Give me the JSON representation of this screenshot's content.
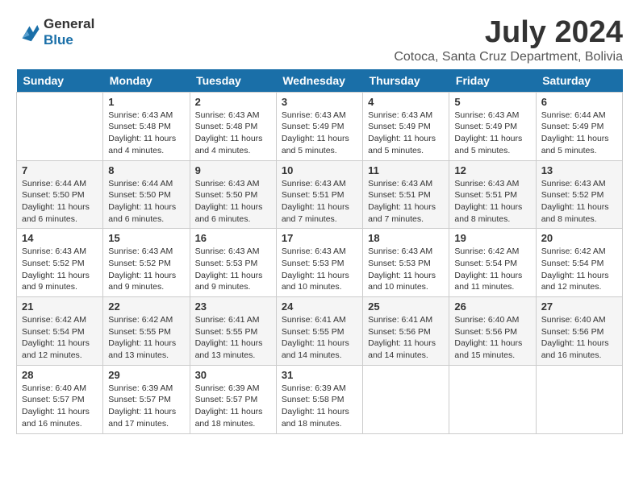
{
  "logo": {
    "line1": "General",
    "line2": "Blue"
  },
  "title": "July 2024",
  "location": "Cotoca, Santa Cruz Department, Bolivia",
  "days_header": [
    "Sunday",
    "Monday",
    "Tuesday",
    "Wednesday",
    "Thursday",
    "Friday",
    "Saturday"
  ],
  "weeks": [
    [
      {
        "day": "",
        "info": ""
      },
      {
        "day": "1",
        "info": "Sunrise: 6:43 AM\nSunset: 5:48 PM\nDaylight: 11 hours\nand 4 minutes."
      },
      {
        "day": "2",
        "info": "Sunrise: 6:43 AM\nSunset: 5:48 PM\nDaylight: 11 hours\nand 4 minutes."
      },
      {
        "day": "3",
        "info": "Sunrise: 6:43 AM\nSunset: 5:49 PM\nDaylight: 11 hours\nand 5 minutes."
      },
      {
        "day": "4",
        "info": "Sunrise: 6:43 AM\nSunset: 5:49 PM\nDaylight: 11 hours\nand 5 minutes."
      },
      {
        "day": "5",
        "info": "Sunrise: 6:43 AM\nSunset: 5:49 PM\nDaylight: 11 hours\nand 5 minutes."
      },
      {
        "day": "6",
        "info": "Sunrise: 6:44 AM\nSunset: 5:49 PM\nDaylight: 11 hours\nand 5 minutes."
      }
    ],
    [
      {
        "day": "7",
        "info": "Sunrise: 6:44 AM\nSunset: 5:50 PM\nDaylight: 11 hours\nand 6 minutes."
      },
      {
        "day": "8",
        "info": "Sunrise: 6:44 AM\nSunset: 5:50 PM\nDaylight: 11 hours\nand 6 minutes."
      },
      {
        "day": "9",
        "info": "Sunrise: 6:43 AM\nSunset: 5:50 PM\nDaylight: 11 hours\nand 6 minutes."
      },
      {
        "day": "10",
        "info": "Sunrise: 6:43 AM\nSunset: 5:51 PM\nDaylight: 11 hours\nand 7 minutes."
      },
      {
        "day": "11",
        "info": "Sunrise: 6:43 AM\nSunset: 5:51 PM\nDaylight: 11 hours\nand 7 minutes."
      },
      {
        "day": "12",
        "info": "Sunrise: 6:43 AM\nSunset: 5:51 PM\nDaylight: 11 hours\nand 8 minutes."
      },
      {
        "day": "13",
        "info": "Sunrise: 6:43 AM\nSunset: 5:52 PM\nDaylight: 11 hours\nand 8 minutes."
      }
    ],
    [
      {
        "day": "14",
        "info": "Sunrise: 6:43 AM\nSunset: 5:52 PM\nDaylight: 11 hours\nand 9 minutes."
      },
      {
        "day": "15",
        "info": "Sunrise: 6:43 AM\nSunset: 5:52 PM\nDaylight: 11 hours\nand 9 minutes."
      },
      {
        "day": "16",
        "info": "Sunrise: 6:43 AM\nSunset: 5:53 PM\nDaylight: 11 hours\nand 9 minutes."
      },
      {
        "day": "17",
        "info": "Sunrise: 6:43 AM\nSunset: 5:53 PM\nDaylight: 11 hours\nand 10 minutes."
      },
      {
        "day": "18",
        "info": "Sunrise: 6:43 AM\nSunset: 5:53 PM\nDaylight: 11 hours\nand 10 minutes."
      },
      {
        "day": "19",
        "info": "Sunrise: 6:42 AM\nSunset: 5:54 PM\nDaylight: 11 hours\nand 11 minutes."
      },
      {
        "day": "20",
        "info": "Sunrise: 6:42 AM\nSunset: 5:54 PM\nDaylight: 11 hours\nand 12 minutes."
      }
    ],
    [
      {
        "day": "21",
        "info": "Sunrise: 6:42 AM\nSunset: 5:54 PM\nDaylight: 11 hours\nand 12 minutes."
      },
      {
        "day": "22",
        "info": "Sunrise: 6:42 AM\nSunset: 5:55 PM\nDaylight: 11 hours\nand 13 minutes."
      },
      {
        "day": "23",
        "info": "Sunrise: 6:41 AM\nSunset: 5:55 PM\nDaylight: 11 hours\nand 13 minutes."
      },
      {
        "day": "24",
        "info": "Sunrise: 6:41 AM\nSunset: 5:55 PM\nDaylight: 11 hours\nand 14 minutes."
      },
      {
        "day": "25",
        "info": "Sunrise: 6:41 AM\nSunset: 5:56 PM\nDaylight: 11 hours\nand 14 minutes."
      },
      {
        "day": "26",
        "info": "Sunrise: 6:40 AM\nSunset: 5:56 PM\nDaylight: 11 hours\nand 15 minutes."
      },
      {
        "day": "27",
        "info": "Sunrise: 6:40 AM\nSunset: 5:56 PM\nDaylight: 11 hours\nand 16 minutes."
      }
    ],
    [
      {
        "day": "28",
        "info": "Sunrise: 6:40 AM\nSunset: 5:57 PM\nDaylight: 11 hours\nand 16 minutes."
      },
      {
        "day": "29",
        "info": "Sunrise: 6:39 AM\nSunset: 5:57 PM\nDaylight: 11 hours\nand 17 minutes."
      },
      {
        "day": "30",
        "info": "Sunrise: 6:39 AM\nSunset: 5:57 PM\nDaylight: 11 hours\nand 18 minutes."
      },
      {
        "day": "31",
        "info": "Sunrise: 6:39 AM\nSunset: 5:58 PM\nDaylight: 11 hours\nand 18 minutes."
      },
      {
        "day": "",
        "info": ""
      },
      {
        "day": "",
        "info": ""
      },
      {
        "day": "",
        "info": ""
      }
    ]
  ]
}
